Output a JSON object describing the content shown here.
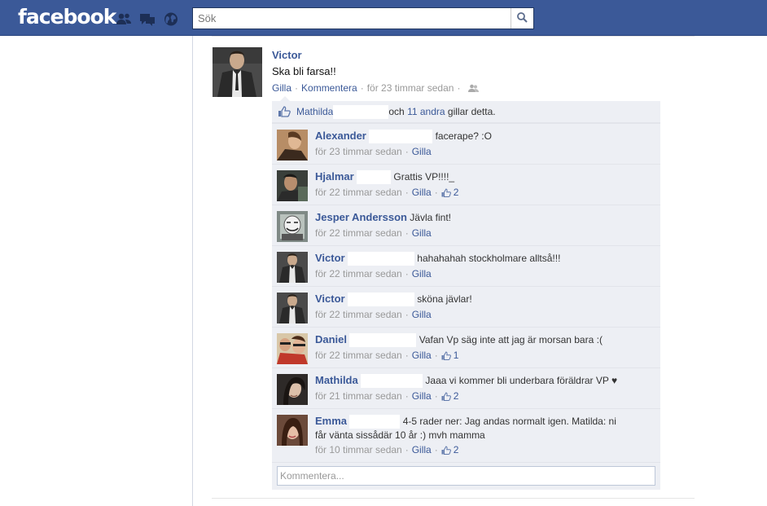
{
  "header": {
    "logo": "facebook",
    "search_placeholder": "Sök"
  },
  "post": {
    "author": "Victor",
    "text": "Ska bli farsa!!",
    "like_label": "Gilla",
    "comment_label": "Kommentera",
    "timestamp": "för 23 timmar sedan"
  },
  "likes": {
    "first_name": "Mathilda",
    "and": "och",
    "others": "11 andra",
    "suffix": "gillar detta."
  },
  "comments": [
    {
      "author": "Alexander",
      "text": "facerape? :O",
      "time": "för 23 timmar sedan",
      "like": "Gilla",
      "likes": ""
    },
    {
      "author": "Hjalmar",
      "text": "Grattis VP!!!!_",
      "time": "för 22 timmar sedan",
      "like": "Gilla",
      "likes": "2"
    },
    {
      "author": "Jesper Andersson",
      "text": "Jävla fint!",
      "time": "för 22 timmar sedan",
      "like": "Gilla",
      "likes": ""
    },
    {
      "author": "Victor",
      "text": "hahahahah stockholmare alltså!!!",
      "time": "för 22 timmar sedan",
      "like": "Gilla",
      "likes": ""
    },
    {
      "author": "Victor",
      "text": "sköna jävlar!",
      "time": "för 22 timmar sedan",
      "like": "Gilla",
      "likes": ""
    },
    {
      "author": "Daniel",
      "text": "Vafan Vp säg inte att jag är morsan bara :(",
      "time": "för 22 timmar sedan",
      "like": "Gilla",
      "likes": "1"
    },
    {
      "author": "Mathilda",
      "text": "Jaaa vi kommer bli underbara föräldrar VP ♥",
      "time": "för 21 timmar sedan",
      "like": "Gilla",
      "likes": "2"
    },
    {
      "author": "Emma",
      "text_line1": "4-5 rader ner: Jag andas normalt igen. Matilda: ni",
      "text_line2": "får vänta sissådär 10 år :) mvh mamma",
      "time": "för 10 timmar sedan",
      "like": "Gilla",
      "likes": "2"
    }
  ],
  "comment_box": {
    "placeholder": "Kommentera..."
  },
  "colors": {
    "brand": "#3b5998",
    "ufi_bg": "#edeff4"
  },
  "icons": {
    "friends": "friends-icon",
    "messages": "messages-icon",
    "notifications": "globe-icon",
    "search": "search-icon",
    "audience": "friends-audience-icon",
    "like": "thumbs-up-icon"
  }
}
